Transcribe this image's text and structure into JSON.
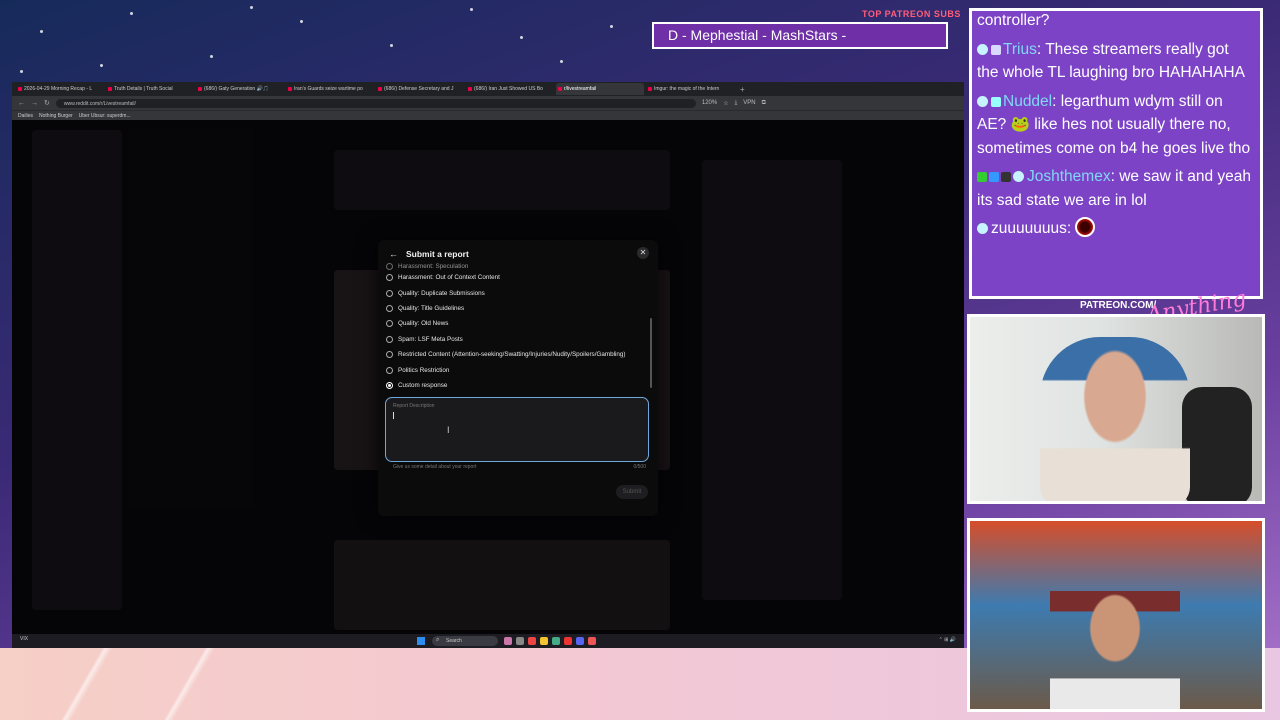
{
  "overlay": {
    "patreon_label": "TOP PATREON SUBS",
    "sub_ticker": "D - Mephestial - MashStars -"
  },
  "browser": {
    "tabs": [
      {
        "label": "2026-04-29 Morning Recap - L",
        "active": false
      },
      {
        "label": "Truth Details | Truth Social",
        "active": false
      },
      {
        "label": "(686/) Gaty Generation 🔊🎵",
        "active": false
      },
      {
        "label": "Iran's Guards seize wartime po",
        "active": false
      },
      {
        "label": "(686/) Defense Secretary and J",
        "active": false
      },
      {
        "label": "(686/) Iran Just Showed US Bo",
        "active": false
      },
      {
        "label": "r/livestreamfail",
        "active": true
      },
      {
        "label": "Imgur: the magic of the Intern",
        "active": false
      }
    ],
    "url": "www.reddit.com/r/Livestreamfail/",
    "zoom": "120%",
    "vpn": "VPN",
    "bookmarks": [
      "Dailies",
      "Nothing Burger",
      "Uber Ubsur: superdm..."
    ]
  },
  "modal": {
    "title": "Submit a report",
    "options": [
      {
        "label": "Harassment: Speculation",
        "selected": false,
        "cut": true
      },
      {
        "label": "Harassment: Out of Context Content",
        "selected": false
      },
      {
        "label": "Quality: Duplicate Submissions",
        "selected": false
      },
      {
        "label": "Quality: Title Guidelines",
        "selected": false
      },
      {
        "label": "Quality: Old News",
        "selected": false
      },
      {
        "label": "Spam: LSF Meta Posts",
        "selected": false
      },
      {
        "label": "Restricted Content (Attention-seeking/Swatting/Injuries/Nudity/Spoilers/Gambling)",
        "selected": false
      },
      {
        "label": "Politics Restriction",
        "selected": false
      },
      {
        "label": "Custom response",
        "selected": true
      }
    ],
    "description_placeholder": "Report Description",
    "helper": "Give us some detail about your report",
    "counter": "0/500",
    "submit_label": "Submit"
  },
  "taskbar": {
    "weather": "VIX",
    "search_label": "Search"
  },
  "chat": {
    "partial_line": "controller?",
    "messages": [
      {
        "user": "Trius",
        "text": ": These streamers really got the whole TL laughing bro HAHAHAHA"
      },
      {
        "user": "Nuddel",
        "text": ": legarthum wdym still on AE? 🐸 like hes not usually there no, sometimes come on b4 he goes live tho"
      },
      {
        "user": "Joshthemex",
        "text": ": we saw it and yeah its sad state we are in lol"
      },
      {
        "user": "zuuuuuuus",
        "text": ": "
      }
    ]
  },
  "cams": {
    "label": "PATREON.COM/",
    "script": "Anything Else"
  },
  "colors": {
    "accent_blue": "#6fa8dc",
    "chat_bg": "#7d43c7",
    "username": "#7fd8f5"
  }
}
